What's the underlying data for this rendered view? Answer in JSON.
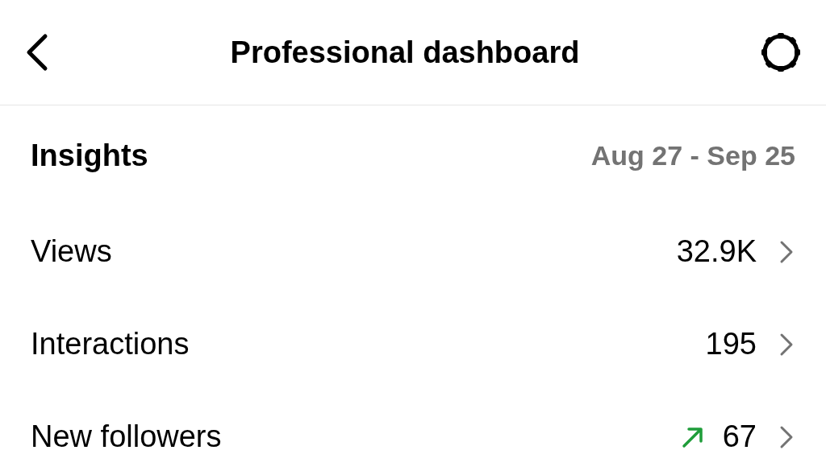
{
  "header": {
    "title": "Professional dashboard"
  },
  "insights": {
    "title": "Insights",
    "date_range": "Aug 27 - Sep 25"
  },
  "rows": [
    {
      "label": "Views",
      "value": "32.9K",
      "trending_up": false
    },
    {
      "label": "Interactions",
      "value": "195",
      "trending_up": false
    },
    {
      "label": "New followers",
      "value": "67",
      "trending_up": true
    }
  ]
}
